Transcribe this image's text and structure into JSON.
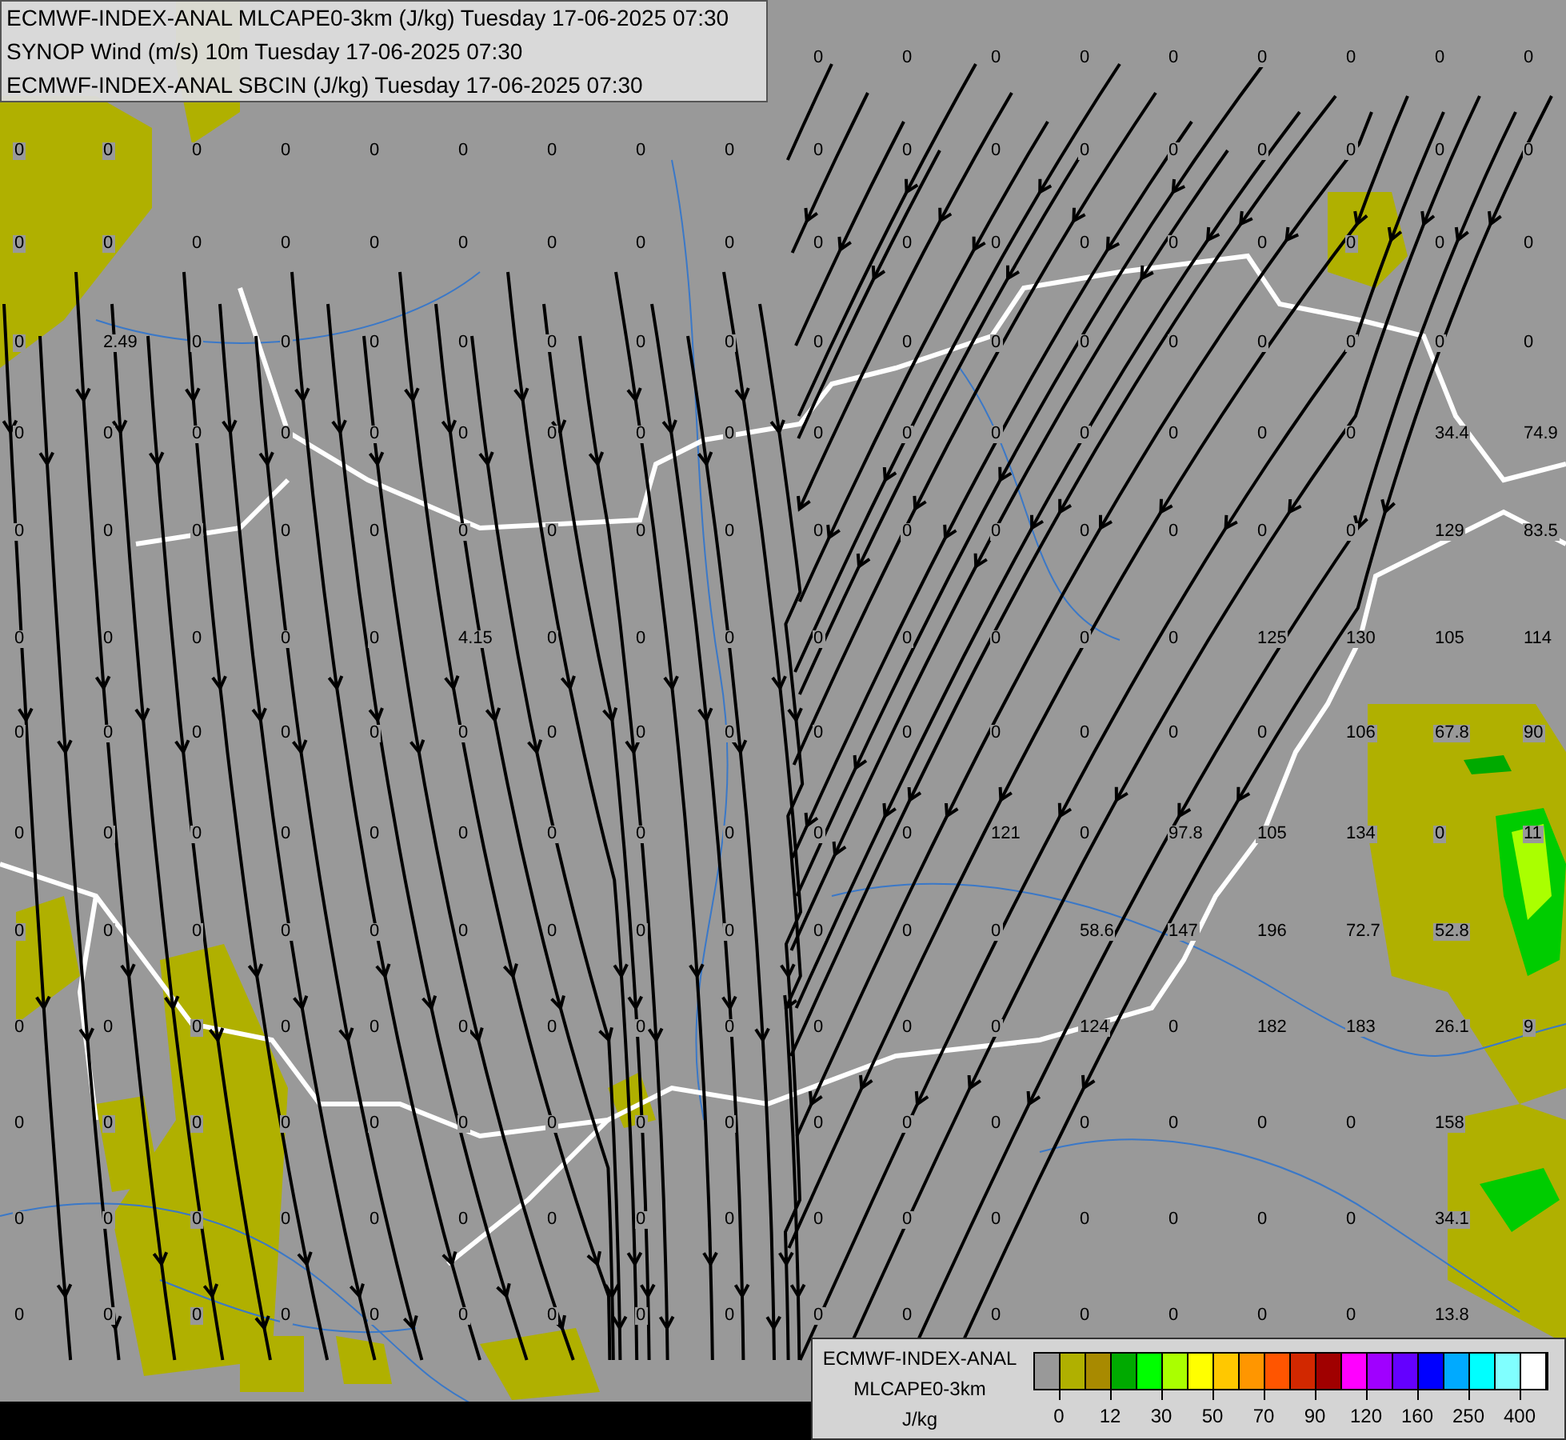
{
  "header": {
    "lines": [
      "ECMWF-INDEX-ANAL MLCAPE0-3km (J/kg) Tuesday 17-06-2025 07:30",
      "SYNOP Wind (m/s) 10m Tuesday 17-06-2025 07:30",
      "ECMWF-INDEX-ANAL SBCIN (J/kg) Tuesday 17-06-2025 07:30"
    ]
  },
  "top_row_values": [
    "0",
    "0",
    "0",
    "0",
    "0",
    "0",
    "0",
    "0",
    "0"
  ],
  "station_values": [
    [
      "0",
      "0",
      "0",
      "0",
      "0",
      "0",
      "0",
      "0",
      "0",
      "0",
      "0",
      "0",
      "0",
      "0",
      "0",
      "0",
      "0",
      "0"
    ],
    [
      "0",
      "0",
      "0",
      "0",
      "0",
      "0",
      "0",
      "0",
      "0",
      "0",
      "0",
      "0",
      "0",
      "0",
      "0",
      "0",
      "0",
      "0"
    ],
    [
      "0",
      "2.49",
      "0",
      "0",
      "0",
      "0",
      "0",
      "0",
      "0",
      "0",
      "0",
      "0",
      "0",
      "0",
      "0",
      "0",
      "0",
      "0"
    ],
    [
      "0",
      "0",
      "0",
      "0",
      "0",
      "0",
      "0",
      "0",
      "0",
      "0",
      "0",
      "0",
      "0",
      "0",
      "0",
      "0",
      "34.4",
      "74.9"
    ],
    [
      "0",
      "0",
      "0",
      "0",
      "0",
      "0",
      "0",
      "0",
      "0",
      "0",
      "0",
      "0",
      "0",
      "0",
      "0",
      "0",
      "129",
      "83.5"
    ],
    [
      "0",
      "0",
      "0",
      "0",
      "0",
      "4.15",
      "0",
      "0",
      "0",
      "0",
      "0",
      "0",
      "0",
      "0",
      "125",
      "130",
      "105",
      "114"
    ],
    [
      "0",
      "0",
      "0",
      "0",
      "0",
      "0",
      "0",
      "0",
      "0",
      "0",
      "0",
      "0",
      "0",
      "0",
      "0",
      "106",
      "67.8",
      "90"
    ],
    [
      "0",
      "0",
      "0",
      "0",
      "0",
      "0",
      "0",
      "0",
      "0",
      "0",
      "0",
      "121",
      "0",
      "97.8",
      "105",
      "134",
      "0",
      "11"
    ],
    [
      "0",
      "0",
      "0",
      "0",
      "0",
      "0",
      "0",
      "0",
      "0",
      "0",
      "0",
      "0",
      "58.6",
      "147",
      "196",
      "72.7",
      "52.8"
    ],
    [
      "0",
      "0",
      "0",
      "0",
      "0",
      "0",
      "0",
      "0",
      "0",
      "0",
      "0",
      "0",
      "124",
      "0",
      "182",
      "183",
      "26.1",
      "9"
    ],
    [
      "0",
      "0",
      "0",
      "0",
      "0",
      "0",
      "0",
      "0",
      "0",
      "0",
      "0",
      "0",
      "0",
      "0",
      "0",
      "0",
      "158"
    ],
    [
      "0",
      "0",
      "0",
      "0",
      "0",
      "0",
      "0",
      "0",
      "0",
      "0",
      "0",
      "0",
      "0",
      "0",
      "0",
      "0",
      "34.1"
    ],
    [
      "0",
      "0",
      "0",
      "0",
      "0",
      "0",
      "0",
      "0",
      "0",
      "0",
      "0",
      "0",
      "0",
      "0",
      "0",
      "0",
      "13.8"
    ]
  ],
  "legend": {
    "title_lines": [
      "ECMWF-INDEX-ANAL",
      "MLCAPE0-3km",
      "J/kg"
    ],
    "swatches": [
      {
        "color": "#999999"
      },
      {
        "color": "#b0b000"
      },
      {
        "color": "#a88a00"
      },
      {
        "color": "#00aa00"
      },
      {
        "color": "#00ff00"
      },
      {
        "color": "#aaff00"
      },
      {
        "color": "#ffff00"
      },
      {
        "color": "#ffc800"
      },
      {
        "color": "#ff9600"
      },
      {
        "color": "#ff5500"
      },
      {
        "color": "#d22800"
      },
      {
        "color": "#a00000"
      },
      {
        "color": "#ff00ff"
      },
      {
        "color": "#a000ff"
      },
      {
        "color": "#6400ff"
      },
      {
        "color": "#0000ff"
      },
      {
        "color": "#00aaff"
      },
      {
        "color": "#00ffff"
      },
      {
        "color": "#80ffff"
      },
      {
        "color": "#ffffff"
      }
    ],
    "ticks": [
      "0",
      "12",
      "30",
      "50",
      "70",
      "90",
      "120",
      "160",
      "250",
      "400"
    ]
  }
}
